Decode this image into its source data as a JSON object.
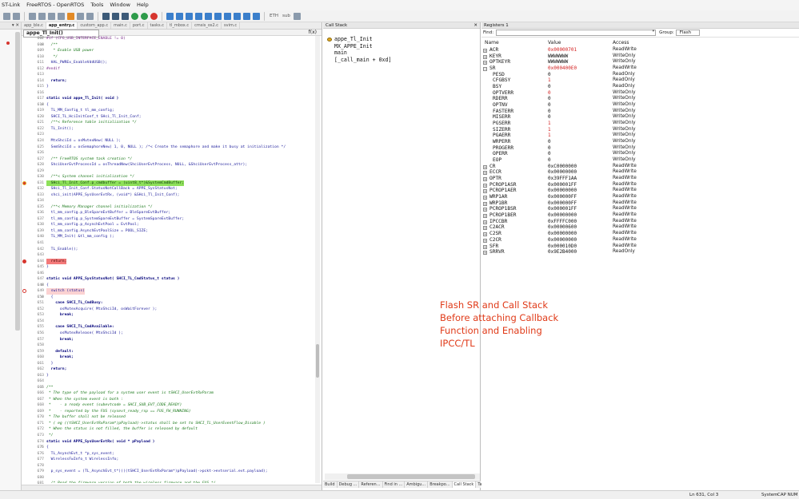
{
  "menu": [
    "ST-Link",
    "FreeRTOS - OpenRTOS",
    "Tools",
    "Window",
    "Help"
  ],
  "toolbar": {
    "combo_label": "ETH",
    "combo_value": "sub"
  },
  "left_pane": {
    "header": "▾ ✕"
  },
  "editor": {
    "tabs": [
      "app_ble.c",
      "app_entry.c",
      "custom_app.c",
      "main.c",
      "port.c",
      "tasks.c",
      "tl_mbox.c",
      "cmsis_os2.c",
      "svim.c"
    ],
    "active_tab": 1,
    "function_nav": "appe_Tl_Init()",
    "nav_icon": "f(x)",
    "lines": [
      {
        "n": "607",
        "t": "#if (CFG_USB_INTERFACE_ENABLE != 0)",
        "c": "pp",
        "f": "⊟"
      },
      {
        "n": "608",
        "t": "  /**",
        "c": "cm",
        "f": "⊟"
      },
      {
        "n": "609",
        "t": "   * Enable USB power",
        "c": "cm"
      },
      {
        "n": "610",
        "t": "   */",
        "c": "cm"
      },
      {
        "n": "611",
        "t": "  HAL_PWREx_EnableVddUSB();",
        "c": ""
      },
      {
        "n": "612",
        "t": "#endif",
        "c": "pp"
      },
      {
        "n": "613",
        "t": "",
        "c": ""
      },
      {
        "n": "614",
        "t": "  return;",
        "c": "kw"
      },
      {
        "n": "615",
        "t": "}",
        "c": ""
      },
      {
        "n": "616",
        "t": "",
        "c": ""
      },
      {
        "n": "617",
        "t": "static void appe_Tl_Init( void )",
        "c": "kw"
      },
      {
        "n": "618",
        "t": "{",
        "c": "",
        "f": "⊟"
      },
      {
        "n": "619",
        "t": "  TL_MM_Config_t tl_mm_config;",
        "c": ""
      },
      {
        "n": "620",
        "t": "  SHCI_TL_HciInitConf_t SHci_Tl_Init_Conf;",
        "c": ""
      },
      {
        "n": "621",
        "t": "  /**< Reference table initialization */",
        "c": "cm"
      },
      {
        "n": "622",
        "t": "  TL_Init();",
        "c": ""
      },
      {
        "n": "623",
        "t": "",
        "c": ""
      },
      {
        "n": "624",
        "t": "  MtxShciId = osMutexNew( NULL );",
        "c": ""
      },
      {
        "n": "625",
        "t": "  SemShciId = osSemaphoreNew( 1, 0, NULL ); /*< Create the semaphore and make it busy at initialization */",
        "c": ""
      },
      {
        "n": "626",
        "t": "",
        "c": ""
      },
      {
        "n": "627",
        "t": "  /** FreeRTOS system task creation */",
        "c": "cm"
      },
      {
        "n": "628",
        "t": "  ShciUserEvtProcessId = osThreadNew(ShciUserEvtProcess, NULL, &ShciUserEvtProcess_attr);",
        "c": ""
      },
      {
        "n": "629",
        "t": "",
        "c": ""
      },
      {
        "n": "630",
        "t": "  /**< System channel initialization */",
        "c": "cm"
      },
      {
        "n": "631",
        "t": "  SHci_Tl_Init_Conf.p_cmdbuffer = (uint8_t*)&SystemCmdBuffer;",
        "c": "hl-green",
        "bp": "arrow"
      },
      {
        "n": "632",
        "t": "  SHci_Tl_Init_Conf.StatusNotCallBack = APPE_SysStatusNot;",
        "c": ""
      },
      {
        "n": "633",
        "t": "  shci_init(APPE_SysUserEvtRx, (void*) &SHci_Tl_Init_Conf);",
        "c": ""
      },
      {
        "n": "634",
        "t": "",
        "c": ""
      },
      {
        "n": "635",
        "t": "  /**< Memory Manager channel initialization */",
        "c": "cm"
      },
      {
        "n": "636",
        "t": "  tl_mm_config.p_BleSpareEvtBuffer = BleSpareEvtBuffer;",
        "c": ""
      },
      {
        "n": "637",
        "t": "  tl_mm_config.p_SystemSpareEvtBuffer = SystemSpareEvtBuffer;",
        "c": ""
      },
      {
        "n": "638",
        "t": "  tl_mm_config.p_AsynchEvtPool = EvtPool;",
        "c": ""
      },
      {
        "n": "639",
        "t": "  tl_mm_config.AsynchEvtPoolSize = POOL_SIZE;",
        "c": ""
      },
      {
        "n": "640",
        "t": "  TL_MM_Init( &tl_mm_config );",
        "c": ""
      },
      {
        "n": "641",
        "t": "",
        "c": ""
      },
      {
        "n": "642",
        "t": "  TL_Enable();",
        "c": ""
      },
      {
        "n": "643",
        "t": "",
        "c": ""
      },
      {
        "n": "644",
        "t": "  return;",
        "c": "hl-red",
        "bp": "filled"
      },
      {
        "n": "645",
        "t": "}",
        "c": ""
      },
      {
        "n": "646",
        "t": "",
        "c": ""
      },
      {
        "n": "647",
        "t": "static void APPE_SysStatusNot( SHCI_TL_CmdStatus_t status )",
        "c": "kw"
      },
      {
        "n": "648",
        "t": "{",
        "c": "",
        "f": "⊟"
      },
      {
        "n": "649",
        "t": "  switch (status)",
        "c": "hl-pink",
        "bp": "hollow"
      },
      {
        "n": "650",
        "t": "  {",
        "c": "",
        "f": "⊟"
      },
      {
        "n": "651",
        "t": "    case SHCI_TL_CmdBusy:",
        "c": "kw"
      },
      {
        "n": "652",
        "t": "      osMutexAcquire( MtxShciId, osWaitForever );",
        "c": ""
      },
      {
        "n": "653",
        "t": "      break;",
        "c": "kw"
      },
      {
        "n": "654",
        "t": "",
        "c": ""
      },
      {
        "n": "655",
        "t": "    case SHCI_TL_CmdAvailable:",
        "c": "kw"
      },
      {
        "n": "656",
        "t": "      osMutexRelease( MtxShciId );",
        "c": ""
      },
      {
        "n": "657",
        "t": "      break;",
        "c": "kw"
      },
      {
        "n": "658",
        "t": "",
        "c": ""
      },
      {
        "n": "659",
        "t": "    default:",
        "c": "kw"
      },
      {
        "n": "660",
        "t": "      break;",
        "c": "kw"
      },
      {
        "n": "661",
        "t": "  }",
        "c": ""
      },
      {
        "n": "662",
        "t": "  return;",
        "c": "kw"
      },
      {
        "n": "663",
        "t": "}",
        "c": ""
      },
      {
        "n": "664",
        "t": "",
        "c": ""
      },
      {
        "n": "665",
        "t": "/**",
        "c": "cm",
        "f": "⊟"
      },
      {
        "n": "666",
        "t": " * The type of the payload for a system user event is tSHCI_UserEvtRxParam",
        "c": "cm"
      },
      {
        "n": "667",
        "t": " * When the system event is both :",
        "c": "cm"
      },
      {
        "n": "668",
        "t": " *    - a ready event (subevtcode = SHCI_SUB_EVT_CODE_READY)",
        "c": "cm"
      },
      {
        "n": "669",
        "t": " *    - reported by the FUS (sysevt_ready_rsp == FUS_FW_RUNNING)",
        "c": "cm"
      },
      {
        "n": "670",
        "t": " * The buffer shall not be released",
        "c": "cm"
      },
      {
        "n": "671",
        "t": " * ( eg ((tSHCI_UserEvtRxParam*)pPayload)->status shall be set to SHCI_TL_UserEventFlow_Disable )",
        "c": "cm"
      },
      {
        "n": "672",
        "t": " * When the status is not filled, the buffer is released by default",
        "c": "cm"
      },
      {
        "n": "673",
        "t": " */",
        "c": "cm"
      },
      {
        "n": "674",
        "t": "static void APPE_SysUserEvtRx( void * pPayload )",
        "c": "kw"
      },
      {
        "n": "675",
        "t": "{",
        "c": "",
        "f": "⊟"
      },
      {
        "n": "676",
        "t": "  TL_AsynchEvt_t *p_sys_event;",
        "c": ""
      },
      {
        "n": "677",
        "t": "  WirelessFwInfo_t WirelessInfo;",
        "c": ""
      },
      {
        "n": "678",
        "t": "",
        "c": ""
      },
      {
        "n": "679",
        "t": "  p_sys_event = (TL_AsynchEvt_t*)(((tSHCI_UserEvtRxParam*)pPayload)->pckt->evtserial.evt.payload);",
        "c": ""
      },
      {
        "n": "680",
        "t": "",
        "c": ""
      },
      {
        "n": "681",
        "t": "  /* Read the firmware version of both the wireless firmware and the FUS */",
        "c": "cm"
      },
      {
        "n": "682",
        "t": "  SHCI_GetWirelessFwInfo( &WirelessInfo );",
        "c": ""
      },
      {
        "n": "683",
        "t": "",
        "c": ""
      },
      {
        "n": "684",
        "t": "  //APP_DBG_MSG(\"Wireless Firmware version %d.%d.%d\\n\", WirelessInfo.VersionMajor, WirelessInfo.VersionMin",
        "c": "cm"
      }
    ]
  },
  "call_stack": {
    "title": "Call Stack",
    "close": "✕",
    "frames": [
      "appe_Tl_Init",
      "MX_APPE_Init",
      "main",
      "[_call_main + 0xd]"
    ],
    "bottom_tabs": [
      "Build",
      "Debug ...",
      "Referen...",
      "Find in ...",
      "Ambigu...",
      "Breakpo...",
      "Call Stack",
      "Tasks"
    ],
    "active_bottom_tab": 6
  },
  "registers": {
    "title": "Registers 1",
    "find_label": "Find:",
    "group_label": "Group:",
    "group_value": "Flash",
    "columns": [
      "Name",
      "Value",
      "Access"
    ],
    "rows": [
      {
        "name": "ACR",
        "value": "0x00000701",
        "access": "ReadWrite",
        "exp": "+",
        "changed": true
      },
      {
        "name": "KEYR",
        "value": "WWWWWWW",
        "access": "WriteOnly",
        "exp": "+"
      },
      {
        "name": "OPTKEYR",
        "value": "WWWWWWW",
        "access": "WriteOnly",
        "exp": "+"
      },
      {
        "name": "SR",
        "value": "0x000400E0",
        "access": "ReadWrite",
        "exp": "−",
        "changed": true
      },
      {
        "name": "PESD",
        "value": "0",
        "access": "ReadOnly",
        "sub": true
      },
      {
        "name": "CFGBSY",
        "value": "1",
        "access": "ReadOnly",
        "sub": true,
        "changed": true
      },
      {
        "name": "BSY",
        "value": "0",
        "access": "ReadOnly",
        "sub": true
      },
      {
        "name": "OPTVERR",
        "value": "0",
        "access": "WriteOnly",
        "sub": true,
        "changed": true
      },
      {
        "name": "RDERR",
        "value": "0",
        "access": "WriteOnly",
        "sub": true
      },
      {
        "name": "OPTNV",
        "value": "0",
        "access": "WriteOnly",
        "sub": true
      },
      {
        "name": "FASTERR",
        "value": "0",
        "access": "WriteOnly",
        "sub": true
      },
      {
        "name": "MISERR",
        "value": "0",
        "access": "WriteOnly",
        "sub": true
      },
      {
        "name": "PGSERR",
        "value": "1",
        "access": "WriteOnly",
        "sub": true,
        "changed": true
      },
      {
        "name": "SIZERR",
        "value": "1",
        "access": "WriteOnly",
        "sub": true,
        "changed": true
      },
      {
        "name": "PGAERR",
        "value": "1",
        "access": "WriteOnly",
        "sub": true,
        "changed": true
      },
      {
        "name": "WRPERR",
        "value": "0",
        "access": "WriteOnly",
        "sub": true
      },
      {
        "name": "PROGERR",
        "value": "0",
        "access": "WriteOnly",
        "sub": true
      },
      {
        "name": "OPERR",
        "value": "0",
        "access": "WriteOnly",
        "sub": true
      },
      {
        "name": "EOP",
        "value": "0",
        "access": "WriteOnly",
        "sub": true
      },
      {
        "name": "CR",
        "value": "0xC0000000",
        "access": "ReadWrite",
        "exp": "+"
      },
      {
        "name": "ECCR",
        "value": "0x00000000",
        "access": "ReadWrite",
        "exp": "+"
      },
      {
        "name": "OPTR",
        "value": "0x39FFF1AA",
        "access": "ReadWrite",
        "exp": "+"
      },
      {
        "name": "PCROP1ASR",
        "value": "0x000001FF",
        "access": "ReadWrite",
        "exp": "+"
      },
      {
        "name": "PCROP1AER",
        "value": "0x00000000",
        "access": "ReadWrite",
        "exp": "+"
      },
      {
        "name": "WRP1AR",
        "value": "0x000000FF",
        "access": "ReadWrite",
        "exp": "+"
      },
      {
        "name": "WRP1BR",
        "value": "0x000000FF",
        "access": "ReadWrite",
        "exp": "+"
      },
      {
        "name": "PCROP1BSR",
        "value": "0x000001FF",
        "access": "ReadWrite",
        "exp": "+"
      },
      {
        "name": "PCROP1BER",
        "value": "0x00000000",
        "access": "ReadWrite",
        "exp": "+"
      },
      {
        "name": "IPCCBR",
        "value": "0xFFFFC000",
        "access": "ReadWrite",
        "exp": "+"
      },
      {
        "name": "C2ACR",
        "value": "0x00000600",
        "access": "ReadWrite",
        "exp": "+"
      },
      {
        "name": "C2SR",
        "value": "0x00000000",
        "access": "ReadWrite",
        "exp": "+"
      },
      {
        "name": "C2CR",
        "value": "0x00000000",
        "access": "ReadWrite",
        "exp": "+"
      },
      {
        "name": "SFR",
        "value": "0x000010D0",
        "access": "ReadWrite",
        "exp": "+"
      },
      {
        "name": "SRRVR",
        "value": "0x9E2B4000",
        "access": "ReadOnly",
        "exp": "+"
      }
    ]
  },
  "annotation": {
    "lines": [
      "Flash SR and Call Stack",
      "Before attaching Callback",
      "Function and Enabling",
      "IPCC/TL"
    ]
  },
  "status": {
    "position": "Ln 631, Col 3",
    "mode": "System",
    "keys": "CAP NUM"
  },
  "colors": {
    "current_line": "#8ee05a",
    "breakpoint_line": "#f47a7a",
    "changed_value": "#d32020",
    "annotation": "#e03a18"
  }
}
